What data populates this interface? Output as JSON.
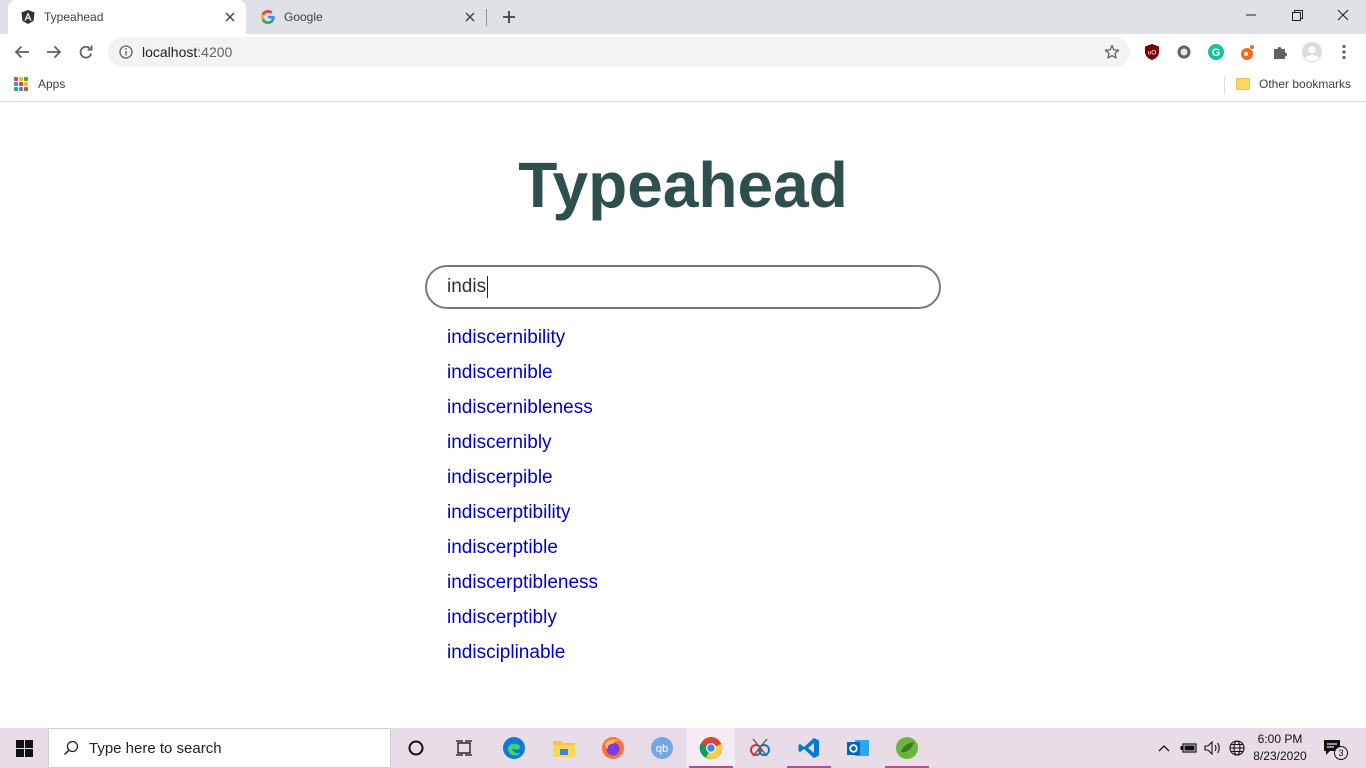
{
  "browser": {
    "tabs": [
      {
        "title": "Typeahead",
        "favicon": "angular-icon",
        "active": true
      },
      {
        "title": "Google",
        "favicon": "google-icon",
        "active": false
      }
    ],
    "url_host": "localhost",
    "url_port": ":4200",
    "bookmarks": {
      "apps_label": "Apps",
      "other_label": "Other bookmarks"
    }
  },
  "page": {
    "heading": "Typeahead",
    "search_value": "indis",
    "results": [
      "indiscernibility",
      "indiscernible",
      "indiscernibleness",
      "indiscernibly",
      "indiscerpible",
      "indiscerptibility",
      "indiscerptible",
      "indiscerptibleness",
      "indiscerptibly",
      "indisciplinable"
    ],
    "colors": {
      "heading": "#2f4f4f",
      "result_link": "#0000cd"
    }
  },
  "taskbar": {
    "search_placeholder": "Type here to search",
    "time": "6:00 PM",
    "date": "8/23/2020",
    "notification_count": "3"
  }
}
